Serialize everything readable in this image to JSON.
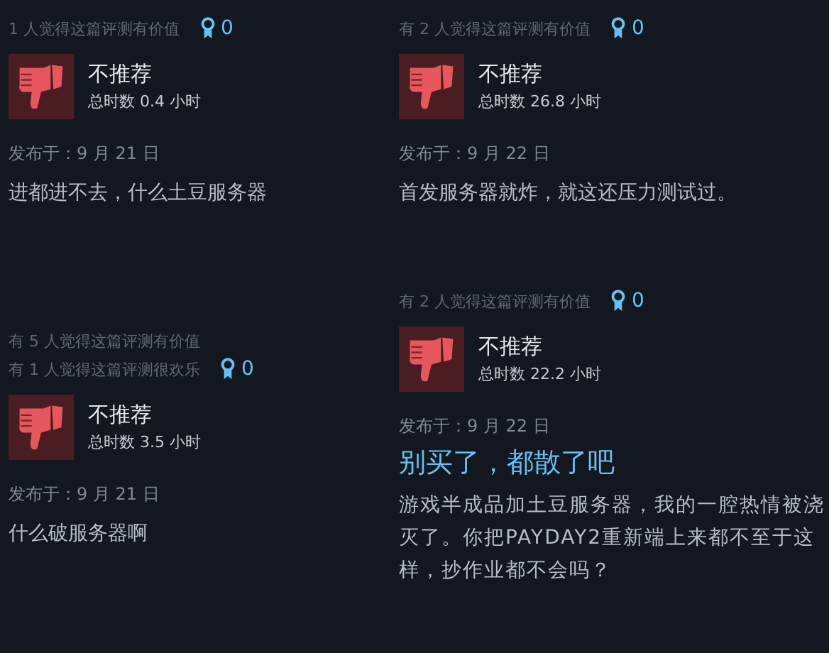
{
  "columns": [
    {
      "reviews": [
        {
          "helpful": [
            "1 人觉得这篇评测有价值"
          ],
          "awards": "0",
          "verdict": "不推荐",
          "hours": "总时数 0.4 小时",
          "posted": "发布于：9 月 21 日",
          "body": "进都进不去，什么土豆服务器"
        },
        {
          "helpful": [
            "有 5 人觉得这篇评测有价值",
            "有 1 人觉得这篇评测很欢乐"
          ],
          "awards": "0",
          "verdict": "不推荐",
          "hours": "总时数 3.5 小时",
          "posted": "发布于：9 月 21 日",
          "body": "什么破服务器啊"
        }
      ]
    },
    {
      "reviews": [
        {
          "helpful": [
            "有 2 人觉得这篇评测有价值"
          ],
          "awards": "0",
          "verdict": "不推荐",
          "hours": "总时数 26.8 小时",
          "posted": "发布于：9 月 22 日",
          "body": "首发服务器就炸，就这还压力测试过。"
        },
        {
          "helpful": [
            "有 2 人觉得这篇评测有价值"
          ],
          "awards": "0",
          "verdict": "不推荐",
          "hours": "总时数 22.2 小时",
          "posted": "发布于：9 月 22 日",
          "title": "别买了，都散了吧",
          "body": "游戏半成品加土豆服务器，我的一腔热情被浇灭了。你把PAYDAY2重新端上来都不至于这样，抄作业都不会吗？"
        }
      ]
    }
  ]
}
